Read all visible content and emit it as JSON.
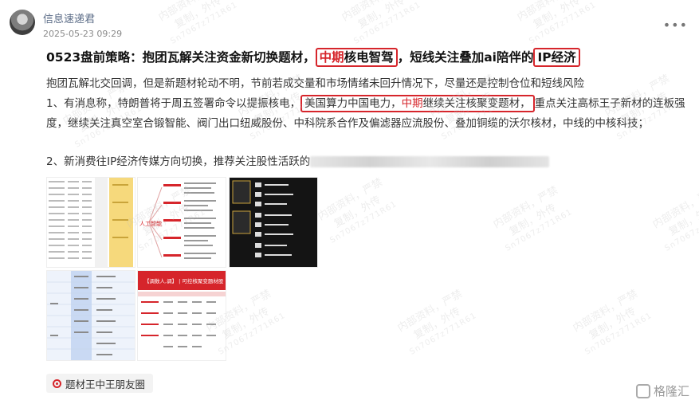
{
  "post": {
    "author": "信息速递君",
    "time": "2025-05-23 09:29",
    "more_icon": "ellipsis-icon",
    "title": {
      "part1": "0523盘前策略：抱团瓦解关注资金新切换题材，",
      "hl1_red": "中期",
      "hl1_rest": "核电智驾",
      "part2": "，短线关注叠加ai陪伴的",
      "hl2": "IP经济"
    },
    "para1": "抱团瓦解北交回调，但是新题材轮动不明，节前若成交量和市场情绪未回升情况下，尽量还是控制仓位和短线风险",
    "para2": {
      "lead": "1、有消息称，特朗普将于周五签署命令以提振核电，",
      "hl_a": "美国算力中国电力，",
      "hl_red": "中期",
      "hl_b": "继续关注核聚变题材，",
      "tail": "重点关注高标王子新材的连板强度，继续关注真空室合锻智能、阀门出口纽威股份、中科院系合作及偏滤器应流股份、叠加铜缆的沃尔核材，中线的中核科技；"
    },
    "para3": "2、新消费往IP经济传媒方向切换，推荐关注股性活跃的",
    "t5_header": "【调数人,调】 | 可控核聚变题材股",
    "t2_side": "人工智能",
    "tag": {
      "icon": "topic-icon",
      "label": "题材王中王朋友圈"
    }
  },
  "watermark": {
    "line1": "内部资料，严禁",
    "line2": "复制，外传",
    "line3": "Sn7067z771R61"
  },
  "brand": {
    "icon": "gelonghui-logo-icon",
    "label": "格隆汇"
  },
  "colors": {
    "highlight": "#d6252b",
    "author": "#5a6b86"
  }
}
